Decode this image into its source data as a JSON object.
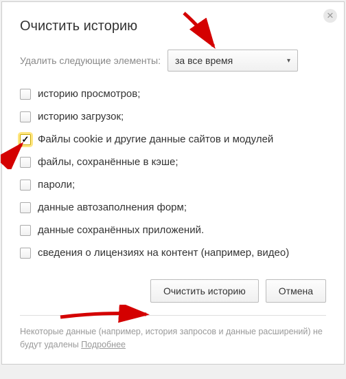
{
  "title": "Очистить историю",
  "period": {
    "label": "Удалить следующие элементы:",
    "selected": "за все время"
  },
  "checkboxes": [
    {
      "label": "историю просмотров;",
      "checked": false
    },
    {
      "label": "историю загрузок;",
      "checked": false
    },
    {
      "label": "Файлы cookie и другие данные сайтов и модулей",
      "checked": true
    },
    {
      "label": "файлы, сохранённые в кэше;",
      "checked": false
    },
    {
      "label": "пароли;",
      "checked": false
    },
    {
      "label": "данные автозаполнения форм;",
      "checked": false
    },
    {
      "label": "данные сохранённых приложений.",
      "checked": false
    },
    {
      "label": "сведения о лицензиях на контент (например, видео)",
      "checked": false
    }
  ],
  "buttons": {
    "clear": "Очистить историю",
    "cancel": "Отмена"
  },
  "footer": {
    "text": "Некоторые данные (например, история запросов и данные расширений) не будут удалены ",
    "link": "Подробнее"
  }
}
